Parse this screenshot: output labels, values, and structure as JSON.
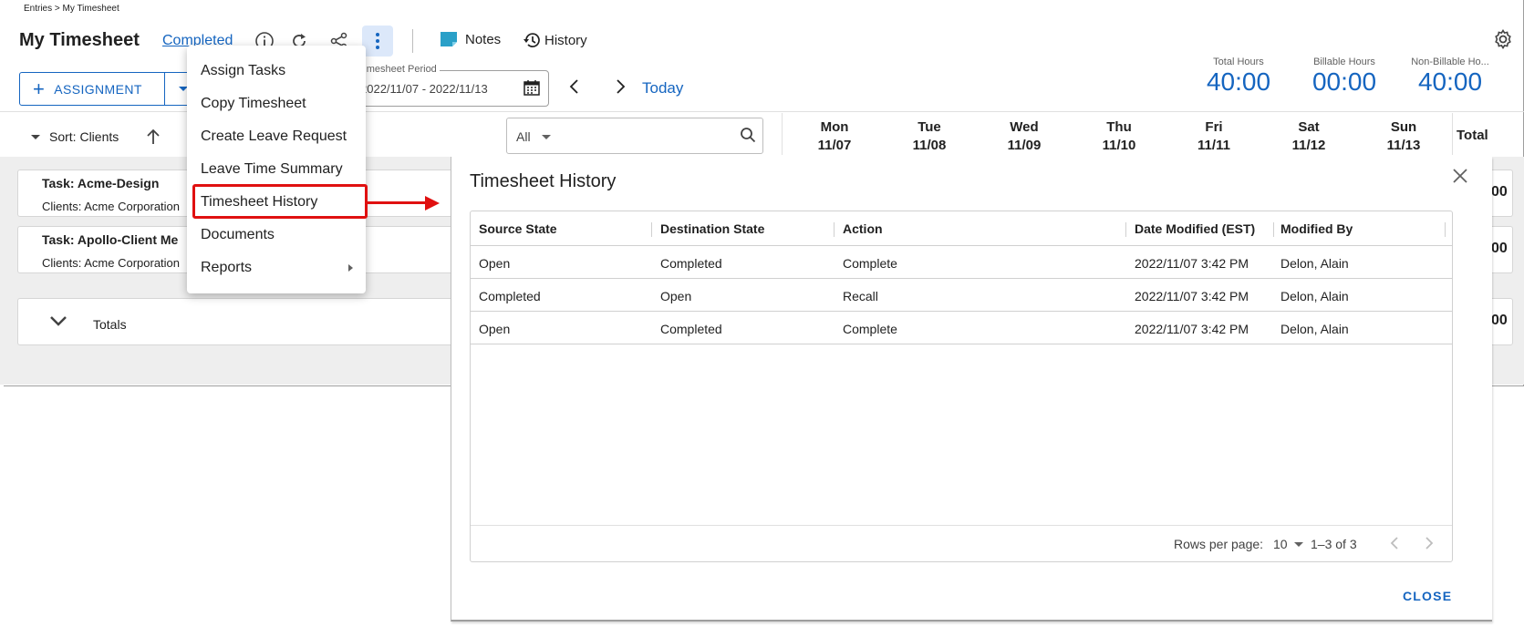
{
  "breadcrumb": "Entries > My Timesheet",
  "header": {
    "title": "My Timesheet",
    "status": "Completed",
    "notes_label": "Notes",
    "history_label": "History"
  },
  "toolbar": {
    "assignment_label": "ASSIGNMENT",
    "period_label": "Timesheet Period",
    "period_value": "2022/11/07 - 2022/11/13",
    "today_label": "Today"
  },
  "stats": [
    {
      "label": "Total Hours",
      "value": "40:00"
    },
    {
      "label": "Billable Hours",
      "value": "00:00"
    },
    {
      "label": "Non-Billable Ho...",
      "value": "40:00"
    }
  ],
  "grid": {
    "sort_label": "Sort: Clients",
    "filter_value": "All",
    "days": [
      {
        "day": "Mon",
        "date": "11/07"
      },
      {
        "day": "Tue",
        "date": "11/08"
      },
      {
        "day": "Wed",
        "date": "11/09"
      },
      {
        "day": "Thu",
        "date": "11/10"
      },
      {
        "day": "Fri",
        "date": "11/11"
      },
      {
        "day": "Sat",
        "date": "11/12"
      },
      {
        "day": "Sun",
        "date": "11/13"
      }
    ],
    "total_label": "Total",
    "tasks": [
      {
        "title": "Task: Acme-Design",
        "client": "Clients: Acme Corporation",
        "total": "00"
      },
      {
        "title": "Task: Apollo-Client Me",
        "client": "Clients: Acme Corporation",
        "total": "00"
      }
    ],
    "totals_label": "Totals",
    "totals_value": "00"
  },
  "menu": {
    "items": [
      "Assign Tasks",
      "Copy Timesheet",
      "Create Leave Request",
      "Leave Time Summary",
      "Timesheet History",
      "Documents",
      "Reports"
    ]
  },
  "dialog": {
    "title": "Timesheet History",
    "columns": [
      "Source State",
      "Destination State",
      "Action",
      "Date Modified (EST)",
      "Modified By"
    ],
    "rows": [
      [
        "Open",
        "Completed",
        "Complete",
        "2022/11/07 3:42 PM",
        "Delon, Alain"
      ],
      [
        "Completed",
        "Open",
        "Recall",
        "2022/11/07 3:42 PM",
        "Delon, Alain"
      ],
      [
        "Open",
        "Completed",
        "Complete",
        "2022/11/07 3:42 PM",
        "Delon, Alain"
      ]
    ],
    "rows_per_page_label": "Rows per page:",
    "rows_per_page_value": "10",
    "range": "1–3 of 3",
    "close_label": "CLOSE"
  },
  "colors": {
    "accent": "#1565c0",
    "highlight": "#e01010",
    "notes_icon": "#2aa0c8"
  }
}
